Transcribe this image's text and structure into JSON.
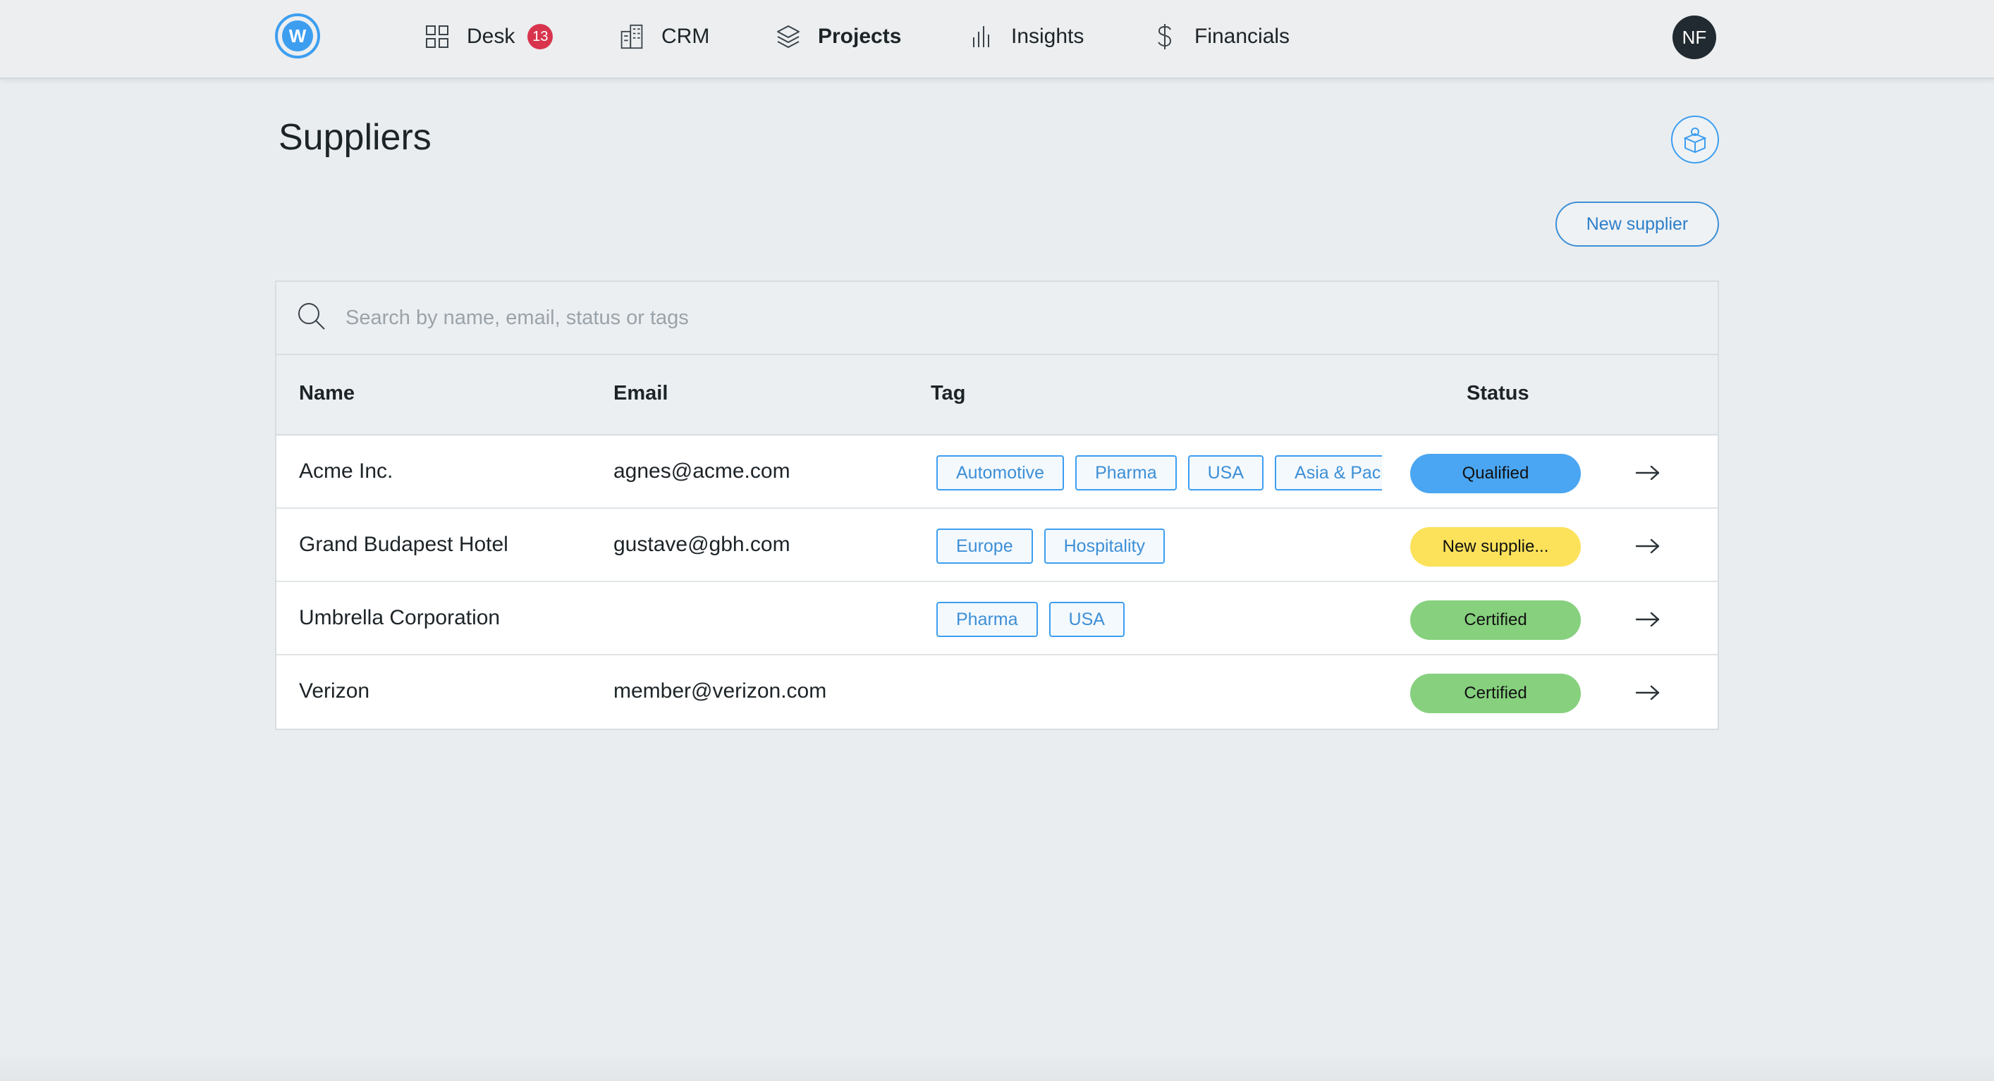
{
  "nav": {
    "items": [
      {
        "label": "Desk",
        "icon": "grid-icon",
        "badge": "13"
      },
      {
        "label": "CRM",
        "icon": "building-icon"
      },
      {
        "label": "Projects",
        "icon": "layers-icon",
        "active": true
      },
      {
        "label": "Insights",
        "icon": "bar-chart-icon"
      },
      {
        "label": "Financials",
        "icon": "dollar-icon"
      }
    ],
    "avatar": "NF",
    "logo_letter": "W"
  },
  "page": {
    "title": "Suppliers",
    "new_button": "New supplier"
  },
  "search": {
    "placeholder": "Search by name, email, status or tags",
    "value": ""
  },
  "table": {
    "columns": [
      "Name",
      "Email",
      "Tag",
      "Status"
    ],
    "rows": [
      {
        "name": "Acme Inc.",
        "email": "agnes@acme.com",
        "tags": [
          "Automotive",
          "Pharma",
          "USA",
          "Asia & Pacific"
        ],
        "status": "Qualified",
        "status_color": "#4aa6f2"
      },
      {
        "name": "Grand Budapest Hotel",
        "email": "gustave@gbh.com",
        "tags": [
          "Europe",
          "Hospitality"
        ],
        "status": "New supplie...",
        "status_color": "#fbe25a"
      },
      {
        "name": "Umbrella Corporation",
        "email": "",
        "tags": [
          "Pharma",
          "USA"
        ],
        "status": "Certified",
        "status_color": "#86d07e"
      },
      {
        "name": "Verizon",
        "email": "member@verizon.com",
        "tags": [],
        "status": "Certified",
        "status_color": "#86d07e"
      }
    ]
  },
  "colors": {
    "accent": "#3d9ef0",
    "badge": "#d8344d",
    "background": "#e9edf0"
  }
}
